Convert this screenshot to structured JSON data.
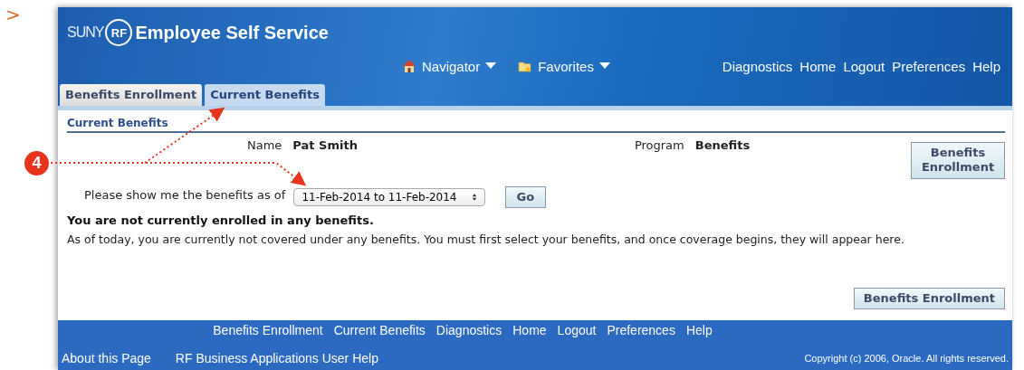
{
  "page_marker": ">",
  "header": {
    "logo_prefix": "SUNY",
    "logo_badge": "RF",
    "title": "Employee Self Service",
    "menus": [
      {
        "kind": "home",
        "label": "Navigator"
      },
      {
        "kind": "folder",
        "label": "Favorites"
      }
    ],
    "links": [
      "Diagnostics",
      "Home",
      "Logout",
      "Preferences",
      "Help"
    ]
  },
  "tabs": [
    {
      "label": "Benefits Enrollment",
      "selected": false
    },
    {
      "label": "Current Benefits",
      "selected": true
    }
  ],
  "section_title": "Current Benefits",
  "fields": [
    {
      "label": "Name",
      "value": "Pat Smith"
    },
    {
      "label": "Program",
      "value": "Benefits"
    }
  ],
  "top_button": "Benefits Enrollment",
  "period": {
    "label": "Please show me the benefits as of",
    "value": "11-Feb-2014 to 11-Feb-2014",
    "go": "Go"
  },
  "message": {
    "heading": "You are not currently enrolled in any benefits.",
    "text": "As of today, you are currently not covered under any benefits. You must first select your benefits, and once coverage begins, they will appear here."
  },
  "bottom_button": "Benefits Enrollment",
  "footer": {
    "links": [
      "Benefits Enrollment",
      "Current Benefits",
      "Diagnostics",
      "Home",
      "Logout",
      "Preferences",
      "Help"
    ],
    "left_links": [
      "About this Page",
      "RF Business Applications User Help"
    ],
    "copyright": "Copyright (c) 2006, Oracle. All rights reserved."
  },
  "callout": {
    "number": "4"
  }
}
